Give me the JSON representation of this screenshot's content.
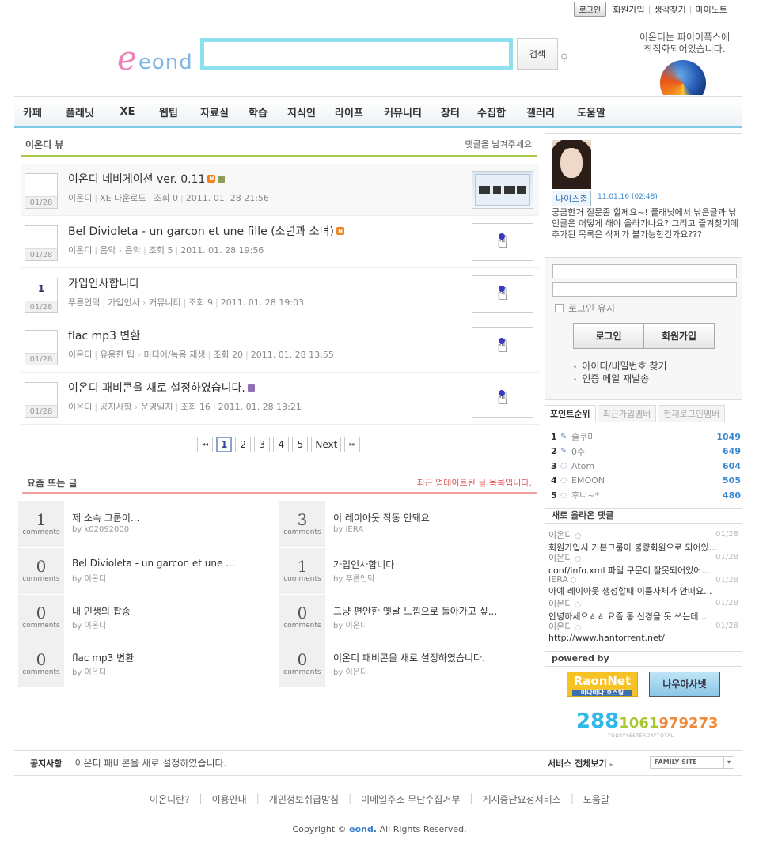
{
  "util": {
    "login": "로그인",
    "join": "회원가입",
    "find": "생각찾기",
    "mynote": "마이노트"
  },
  "logo": {
    "e": "e",
    "text": "eond"
  },
  "search": {
    "button": "검색",
    "value": ""
  },
  "firefox": {
    "line1": "이온디는 파이어폭스에",
    "line2": "최적화되어있습니다."
  },
  "nav": [
    "카페",
    "플래닛",
    "XE",
    "웹팁",
    "자료실",
    "학습",
    "지식인",
    "라이프",
    "커뮤니티",
    "장터",
    "수집합",
    "갤러리",
    "도움말"
  ],
  "view": {
    "title": "이온디 뷰",
    "right": "댓글을 남겨주세요",
    "rows": [
      {
        "count": "",
        "date": "01/28",
        "title": "이온디 네비게이션 ver. 0.11",
        "author": "이온디",
        "cat1": "XE 다운로드",
        "cat2": "",
        "views": "조회 0",
        "time": "2011. 01. 28 21:56"
      },
      {
        "count": "",
        "date": "01/28",
        "title": "Bel Divioleta - un garcon et une fille (소년과 소녀)",
        "author": "이온디",
        "cat1": "음악",
        "cat2": "음악",
        "views": "조회 5",
        "time": "2011. 01. 28 19:56"
      },
      {
        "count": "1",
        "date": "01/28",
        "title": "가입인사합니다",
        "author": "푸른언덕",
        "cat1": "가입인사",
        "cat2": "커뮤니티",
        "views": "조회 9",
        "time": "2011. 01. 28 19:03"
      },
      {
        "count": "",
        "date": "01/28",
        "title": "flac mp3 변환",
        "author": "이온디",
        "cat1": "유용한 팁",
        "cat2": "미디어/녹음·재생",
        "views": "조회 20",
        "time": "2011. 01. 28 13:55"
      },
      {
        "count": "",
        "date": "01/28",
        "title": "이온디 패비콘을 새로 설정하였습니다.",
        "author": "이온디",
        "cat1": "공지사항",
        "cat2": "운영일지",
        "views": "조회 16",
        "time": "2011. 01. 28 13:21"
      }
    ]
  },
  "pager": {
    "prev": "◂◂",
    "pages": [
      "1",
      "2",
      "3",
      "4",
      "5"
    ],
    "next": "Next",
    "last": "▸▸"
  },
  "recent": {
    "title": "요즘 뜨는 글",
    "right": "최근 업데이트된 글 목록입니다.",
    "word": "comments",
    "items": [
      {
        "n": "1",
        "title": "제 소속 그룹이...",
        "by": "by k02092000"
      },
      {
        "n": "3",
        "title": "이 레이아웃 작동 안돼요",
        "by": "by IERA"
      },
      {
        "n": "0",
        "title": "Bel Divioleta - un garcon et une ...",
        "by": "by 이온디"
      },
      {
        "n": "1",
        "title": "가입인사합니다",
        "by": "by 푸른언덕"
      },
      {
        "n": "0",
        "title": "내 인생의 팝송",
        "by": "by 이온디"
      },
      {
        "n": "0",
        "title": "그냥 편안한 옛날 느낌으로 돌아가고 싶...",
        "by": "by 이온디"
      },
      {
        "n": "0",
        "title": "flac mp3 변환",
        "by": "by 이온디"
      },
      {
        "n": "0",
        "title": "이온디 패비콘을 새로 설정하였습니다.",
        "by": "by 이온디"
      }
    ]
  },
  "profile": {
    "nick": "나이스충",
    "when": "11.01.16 (02:48)",
    "msg": "궁금한거 질문좀 할께요~! 플래닛에서 낚은글과 낚인글은 어떻게 해야 올라가나요? 그리고 즐겨찾기에 추가된 목록은 삭제가 불가능한건가요???"
  },
  "login": {
    "keep": "로그인 유지",
    "login": "로그인",
    "join": "회원가입",
    "find": "아이디/비밀번호 찾기",
    "mail": "인증 메일 재발송"
  },
  "ptabs": [
    "포인트순위",
    "최근가입멤버",
    "현재로그인멤버"
  ],
  "points": [
    {
      "r": "1",
      "n": "슬쿠미",
      "p": "1049"
    },
    {
      "r": "2",
      "n": "0수",
      "p": "649"
    },
    {
      "r": "3",
      "n": "Atom",
      "p": "604"
    },
    {
      "r": "4",
      "n": "EMOON",
      "p": "505"
    },
    {
      "r": "5",
      "n": "후니~*",
      "p": "480"
    }
  ],
  "comments": {
    "title": "새로 올라온 댓글",
    "items": [
      {
        "u": "이온디",
        "d": "01/28",
        "x": "회원가입시 기본그룹이 불량회원으로 되어있..."
      },
      {
        "u": "이온디",
        "d": "01/28",
        "x": "conf/info.xml 파일 구문이 잘못되어있어..."
      },
      {
        "u": "IERA",
        "d": "01/28",
        "x": "아예 레이아웃 생성할때 이름자체가 안떠요..."
      },
      {
        "u": "이온디",
        "d": "01/28",
        "x": "안녕하세요ㅎㅎ 요즘 통 신경을 못 쓰는데..."
      },
      {
        "u": "이온디",
        "d": "01/28",
        "x": "http://www.hantorrent.net/"
      }
    ]
  },
  "powered": {
    "title": "powered by",
    "raon": "RaonNet",
    "raon_sub": "아나바다 호스팅",
    "naru": "나우아사넷"
  },
  "counter": {
    "today": "288",
    "yesterday": "1061",
    "total": "979273",
    "label": "TODAYYESTERDAYTOTAL"
  },
  "notice": {
    "label": "공지사항",
    "text": "이온디 패비콘을 새로 설정하였습니다.",
    "service": "서비스 전체보기",
    "family": "FAMILY SITE"
  },
  "footer": [
    "이온디란?",
    "이용안내",
    "개인정보취급방침",
    "이메일주소 무단수집거부",
    "게시중단요청서비스",
    "도움말"
  ],
  "copyright": {
    "pre": "Copyright ©",
    "brand": "eond.",
    "post": "All Rights Reserved."
  }
}
